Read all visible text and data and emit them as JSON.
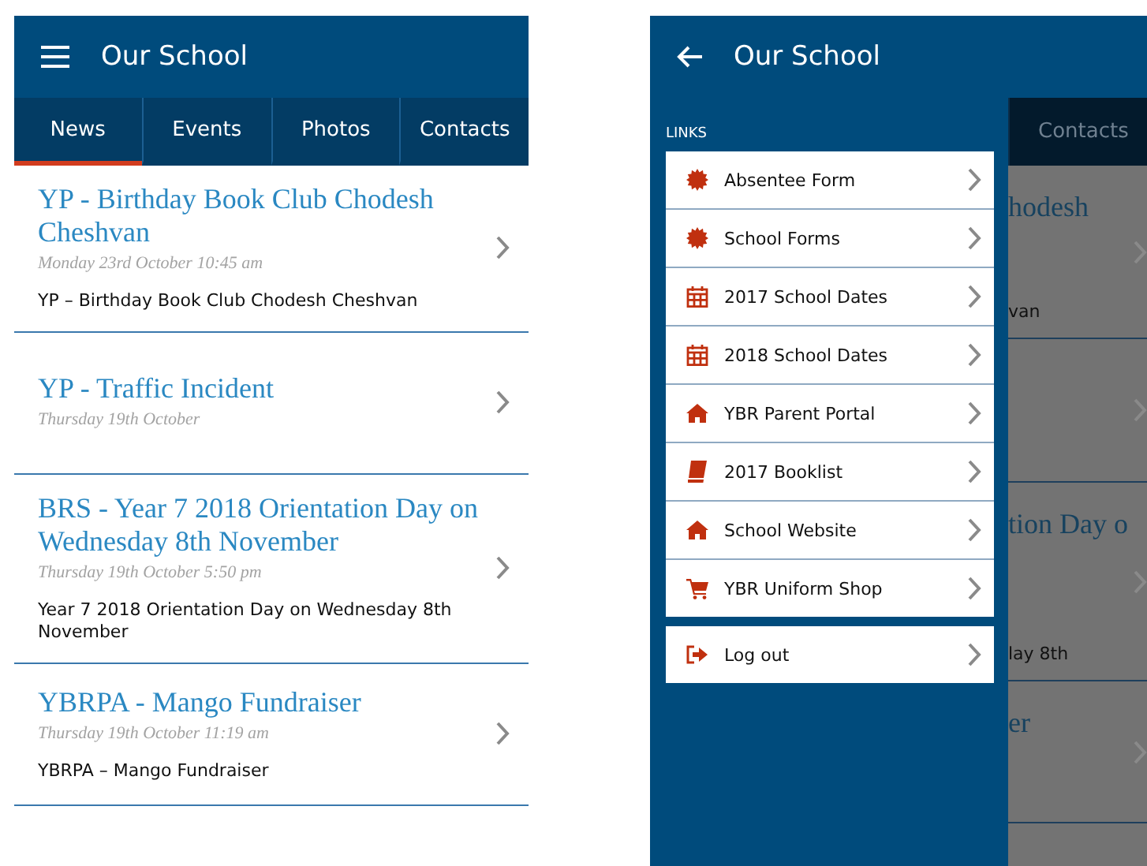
{
  "news_screen": {
    "title": "Our School",
    "tabs": [
      {
        "label": "News",
        "selected": true
      },
      {
        "label": "Events",
        "selected": false
      },
      {
        "label": "Photos",
        "selected": false
      },
      {
        "label": "Contacts",
        "selected": false
      }
    ],
    "articles": [
      {
        "title": "YP - Birthday Book Club Chodesh Cheshvan",
        "date": "Monday 23rd October 10:45 am",
        "summary": "YP – Birthday Book Club Chodesh Cheshvan"
      },
      {
        "title": "YP - Traffic Incident",
        "date": "Thursday 19th October"
      },
      {
        "title": "BRS - Year 7 2018 Orientation Day on Wednesday 8th November",
        "date": "Thursday 19th October 5:50 pm",
        "summary": "Year 7 2018 Orientation Day on Wednesday 8th November"
      },
      {
        "title": "YBRPA - Mango Fundraiser",
        "date": "Thursday 19th October 11:19 am",
        "summary": "YBRPA – Mango Fundraiser"
      }
    ]
  },
  "menu_screen": {
    "title": "Our School",
    "section_label": "LINKS",
    "links": [
      {
        "label": "Absentee Form",
        "kind": "badge"
      },
      {
        "label": "School Forms",
        "kind": "badge"
      },
      {
        "label": "2017 School Dates",
        "kind": "calendar"
      },
      {
        "label": "2018 School Dates",
        "kind": "calendar"
      },
      {
        "label": "YBR Parent Portal",
        "kind": "home"
      },
      {
        "label": "2017 Booklist",
        "kind": "book"
      },
      {
        "label": "School Website",
        "kind": "home"
      },
      {
        "label": "YBR Uniform Shop",
        "kind": "cart"
      }
    ],
    "logout": {
      "label": "Log out",
      "kind": "logout"
    },
    "background": {
      "tab": "Contacts",
      "rows": [
        {
          "title": "hodesh",
          "text": "van"
        },
        {},
        {
          "title": "tion Day o",
          "text": "lay 8th"
        },
        {
          "title": "er"
        }
      ]
    }
  }
}
